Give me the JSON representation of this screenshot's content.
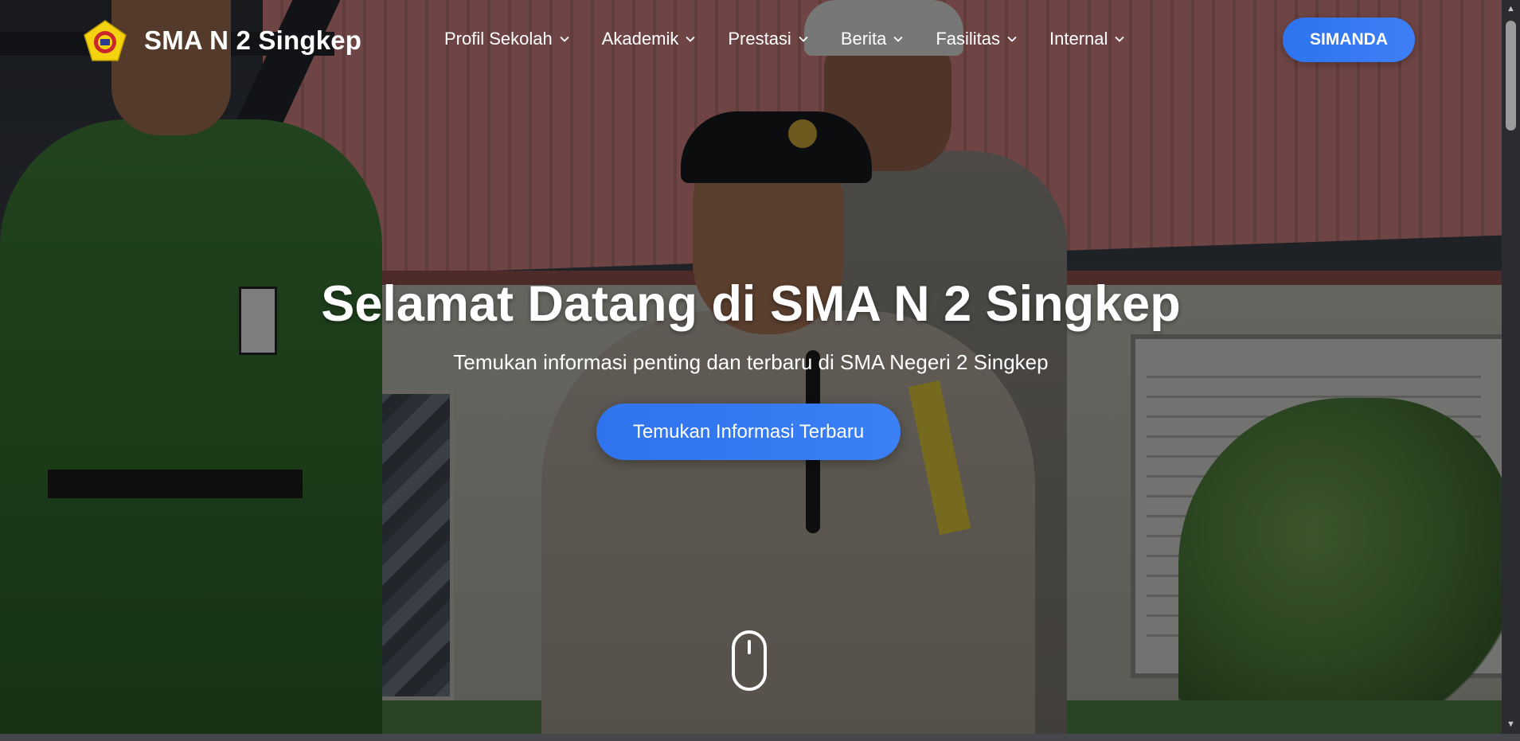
{
  "navbar": {
    "brand": "SMA N 2 Singkep",
    "logo_icon": "school-crest-icon",
    "menu": [
      {
        "label": "Profil Sekolah",
        "icon": "chevron-down-icon"
      },
      {
        "label": "Akademik",
        "icon": "chevron-down-icon"
      },
      {
        "label": "Prestasi",
        "icon": "chevron-down-icon"
      },
      {
        "label": "Berita",
        "icon": "chevron-down-icon"
      },
      {
        "label": "Fasilitas",
        "icon": "chevron-down-icon"
      },
      {
        "label": "Internal",
        "icon": "chevron-down-icon"
      }
    ],
    "cta_label": "SIMANDA"
  },
  "hero": {
    "title": "Selamat Datang di SMA N 2 Singkep",
    "subtitle": "Temukan informasi penting dan terbaru di SMA Negeri 2 Singkep",
    "button_label": "Temukan Informasi Terbaru",
    "scroll_icon": "mouse-scroll-icon"
  },
  "colors": {
    "accent": "#3b7cf5",
    "text": "#ffffff",
    "overlay": "rgba(0,0,0,0.45)",
    "logo_yellow": "#f5d20f",
    "logo_red": "#c8262a"
  }
}
